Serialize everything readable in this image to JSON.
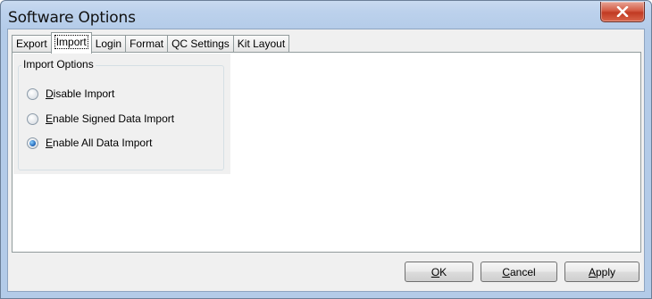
{
  "window": {
    "title": "Software Options",
    "close_glyph": "X"
  },
  "tabs": [
    {
      "label": "Export",
      "active": false
    },
    {
      "label": "Import",
      "active": true
    },
    {
      "label": "Login",
      "active": false
    },
    {
      "label": "Format",
      "active": false
    },
    {
      "label": "QC Settings",
      "active": false
    },
    {
      "label": "Kit Layout",
      "active": false
    }
  ],
  "import_options": {
    "group_label": "Import Options",
    "options": [
      {
        "mnemonic": "D",
        "rest": "isable Import",
        "checked": false
      },
      {
        "mnemonic": "E",
        "rest": "nable Signed Data Import",
        "checked": false
      },
      {
        "mnemonic": "E",
        "rest": "nable All Data Import",
        "checked": true
      }
    ]
  },
  "buttons": {
    "ok": {
      "mnemonic": "O",
      "rest": "K"
    },
    "cancel": {
      "mnemonic": "C",
      "rest": "ancel"
    },
    "apply": {
      "mnemonic": "A",
      "rest": "pply"
    }
  },
  "colors": {
    "title_bar": "#bcd1ec",
    "close_button": "#c13a22",
    "radio_selected": "#1a5fb4"
  }
}
